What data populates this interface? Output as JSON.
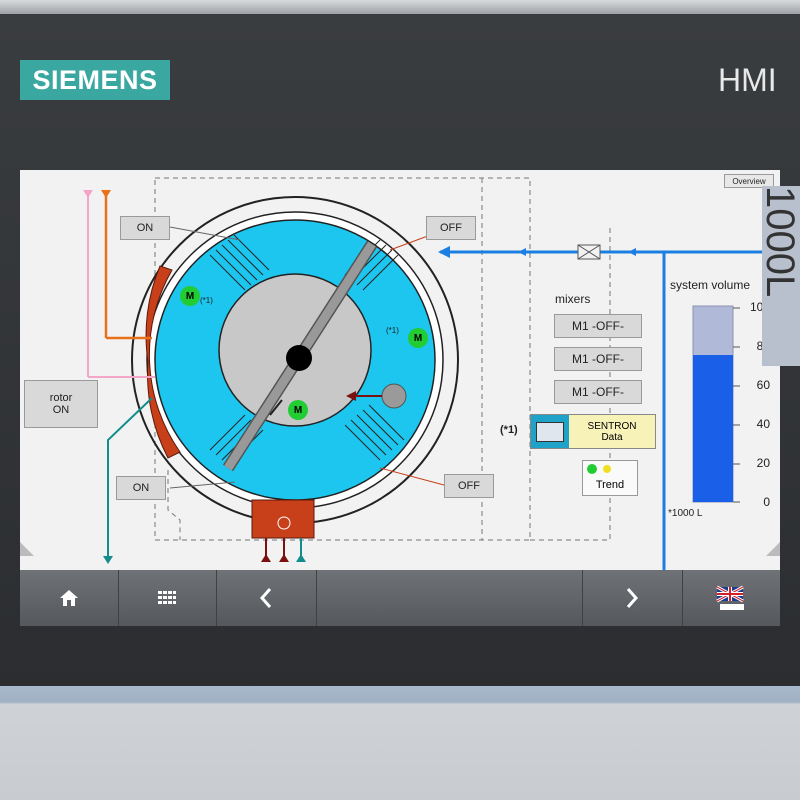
{
  "device": {
    "brand": "SIEMENS",
    "model_label": "HMI",
    "side_label": "1000L"
  },
  "screen": {
    "overview_button": "Overview",
    "rotor_button": {
      "line1": "rotor",
      "line2": "ON"
    },
    "on_top": "ON",
    "on_bottom": "ON",
    "off_top": "OFF",
    "off_bottom": "OFF",
    "motor_label": "M",
    "motor_note": "(*1)",
    "mixers_label": "mixers",
    "mixers": [
      "M1 -OFF-",
      "M1 -OFF-",
      "M1 -OFF-"
    ],
    "sentron_note": "(*1)",
    "sentron": {
      "line1": "SENTRON",
      "line2": "Data"
    },
    "trend_label": "Trend",
    "volume_title": "system volume",
    "volume_unit": "*1000 L",
    "volume_scale": [
      "100",
      "80",
      "60",
      "40",
      "20",
      "0"
    ],
    "volume_level": 75,
    "volume_max": 100
  },
  "colors": {
    "accent_blue": "#1a7fe0",
    "tank_cyan": "#1cc6ef",
    "rotor_red": "#c8401a",
    "teal": "#138c8c",
    "pink": "#f4a6c8",
    "orange": "#e8701a",
    "motor_green": "#22cc33"
  },
  "navbar": {
    "home": "home-icon",
    "menu": "grid-icon",
    "prev": "chevron-left-icon",
    "next": "chevron-right-icon",
    "language": "uk-flag-icon"
  }
}
